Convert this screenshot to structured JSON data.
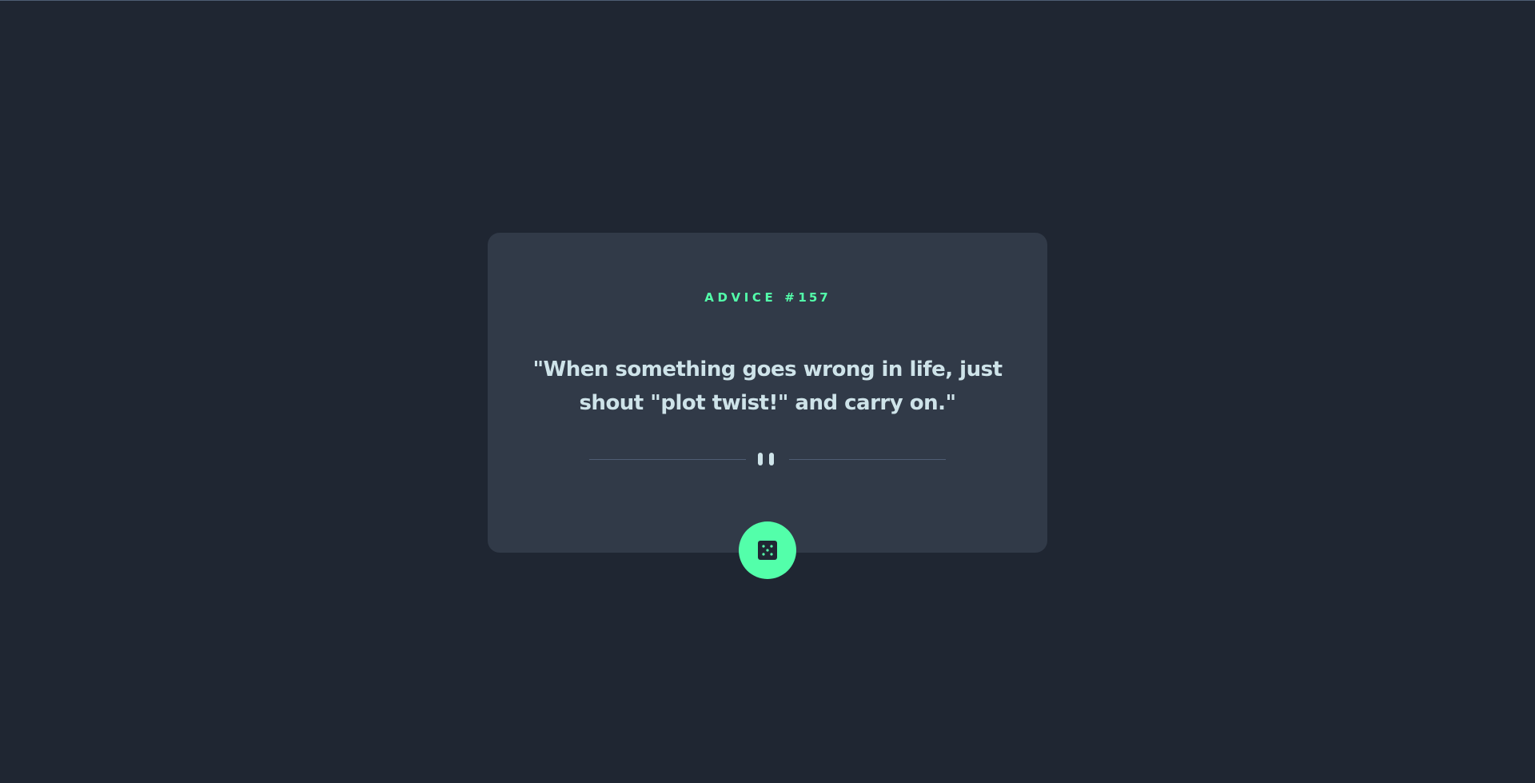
{
  "advice": {
    "label": "ADVICE #",
    "number": "157",
    "quote": "\"When something goes wrong in life, just shout \"plot twist!\" and carry on.\""
  },
  "icons": {
    "divider": "pause-icon",
    "button": "dice-icon"
  },
  "colors": {
    "background": "#1f2632",
    "card": "#313a48",
    "accent": "#53ffaa",
    "text": "#cee3e9",
    "divider": "#4f5d74"
  }
}
